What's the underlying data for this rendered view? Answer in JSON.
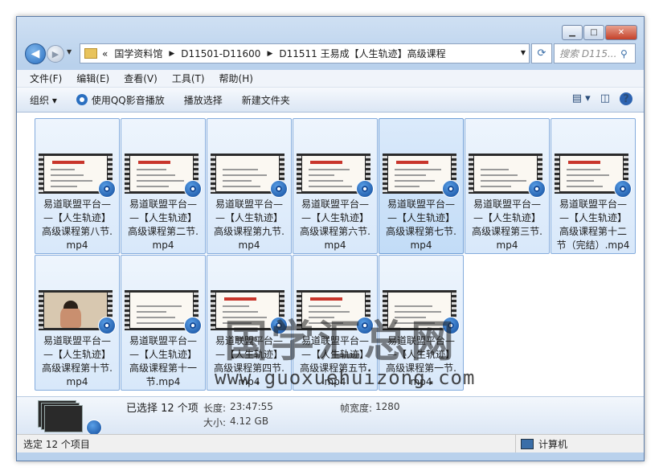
{
  "window": {
    "minimize": "▁",
    "maximize": "□",
    "close": "✕"
  },
  "nav": {
    "back": "◀",
    "forward": "▶",
    "chevrons": "«",
    "breadcrumbs": [
      "国学资料馆",
      "D11501-D11600",
      "D11511 王易成【人生轨迹】高级课程"
    ],
    "search_placeholder": "搜索 D115..."
  },
  "menu": [
    "文件(F)",
    "编辑(E)",
    "查看(V)",
    "工具(T)",
    "帮助(H)"
  ],
  "toolbar": {
    "organize": "组织 ▾",
    "qq_play": "使用QQ影音播放",
    "play_selection": "播放选择",
    "new_folder": "新建文件夹",
    "help": "?"
  },
  "files": [
    "易道联盟平台——【人生轨迹】高级课程第八节.mp4",
    "易道联盟平台——【人生轨迹】高级课程第二节.mp4",
    "易道联盟平台——【人生轨迹】高级课程第九节.mp4",
    "易道联盟平台——【人生轨迹】高级课程第六节.mp4",
    "易道联盟平台——【人生轨迹】高级课程第七节.mp4",
    "易道联盟平台——【人生轨迹】高级课程第三节.mp4",
    "易道联盟平台——【人生轨迹】高级课程第十二节（完结）.mp4",
    "易道联盟平台——【人生轨迹】高级课程第十节.mp4",
    "易道联盟平台——【人生轨迹】高级课程第十一节.mp4",
    "易道联盟平台——【人生轨迹】高级课程第四节.mp4",
    "易道联盟平台——【人生轨迹】高级课程第五节.mp4",
    "易道联盟平台——【人生轨迹】高级课程第一节.mp4"
  ],
  "file_label_lines": [
    [
      "易道联盟平台—",
      "—【人生轨迹】",
      "高级课程第八节.",
      "mp4"
    ],
    [
      "易道联盟平台—",
      "—【人生轨迹】",
      "高级课程第二节.",
      "mp4"
    ],
    [
      "易道联盟平台—",
      "—【人生轨迹】",
      "高级课程第九节.",
      "mp4"
    ],
    [
      "易道联盟平台—",
      "—【人生轨迹】",
      "高级课程第六节.",
      "mp4"
    ],
    [
      "易道联盟平台—",
      "—【人生轨迹】",
      "高级课程第七节.",
      "mp4"
    ],
    [
      "易道联盟平台—",
      "—【人生轨迹】",
      "高级课程第三节.",
      "mp4"
    ],
    [
      "易道联盟平台—",
      "—【人生轨迹】",
      "高级课程第十二",
      "节（完结）.mp4"
    ],
    [
      "易道联盟平台—",
      "—【人生轨迹】",
      "高级课程第十节.",
      "mp4"
    ],
    [
      "易道联盟平台—",
      "—【人生轨迹】",
      "高级课程第十一",
      "节.mp4"
    ],
    [
      "易道联盟平台—",
      "—【人生轨迹】",
      "高级课程第四节.",
      "mp4"
    ],
    [
      "易道联盟平台—",
      "—【人生轨迹】",
      "高级课程第五节.",
      "mp4"
    ],
    [
      "易道联盟平台—",
      "—【人生轨迹】",
      "高级课程第一节.",
      "mp4"
    ]
  ],
  "watermark": {
    "cn": "国学汇总网",
    "url": "www.guoxuehuizong.com"
  },
  "details": {
    "selected": "已选择 12 个项",
    "length_label": "长度:",
    "length_value": "23:47:55",
    "size_label": "大小:",
    "size_value": "4.12 GB",
    "frame_width_label": "帧宽度:",
    "frame_width_value": "1280"
  },
  "status": {
    "left": "选定 12 个项目",
    "right": "计算机"
  }
}
